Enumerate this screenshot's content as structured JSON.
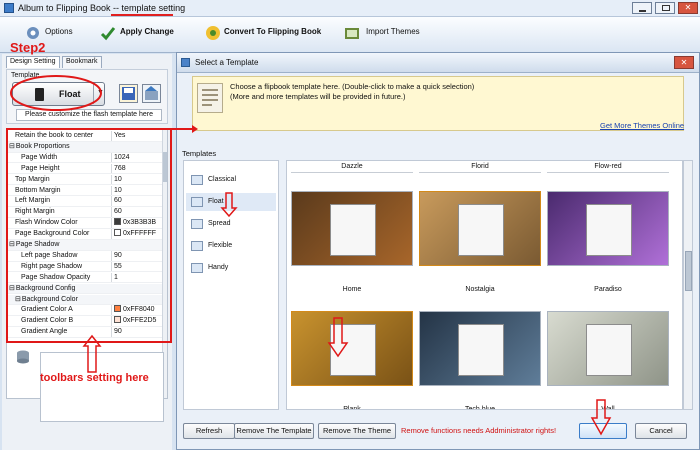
{
  "window": {
    "title": "Album to Flipping Book -- template setting"
  },
  "toolbar": {
    "options_label": "Options",
    "apply_label": "Apply Change",
    "convert_label": "Convert To Flipping Book",
    "themes_label": "Import Themes"
  },
  "left_panel": {
    "tabs": [
      "Design Setting",
      "Bookmark"
    ],
    "template_label": "Template",
    "template_value": "Float",
    "customize_text": "Please customize the flash template here",
    "properties": [
      {
        "label": "Retain the book to center",
        "value": "Yes",
        "indent": 1,
        "group": false
      },
      {
        "label": "Book Proportions",
        "value": "",
        "indent": 0,
        "group": true
      },
      {
        "label": "Page Width",
        "value": "1024",
        "indent": 2,
        "group": false
      },
      {
        "label": "Page Height",
        "value": "768",
        "indent": 2,
        "group": false
      },
      {
        "label": "Top Margin",
        "value": "10",
        "indent": 1,
        "group": false
      },
      {
        "label": "Bottom Margin",
        "value": "10",
        "indent": 1,
        "group": false
      },
      {
        "label": "Left Margin",
        "value": "60",
        "indent": 1,
        "group": false
      },
      {
        "label": "Right Margin",
        "value": "60",
        "indent": 1,
        "group": false
      },
      {
        "label": "Flash Window Color",
        "value": "0x3B3B3B",
        "indent": 1,
        "group": false,
        "swatch": "#3b3b3b"
      },
      {
        "label": "Page Background Color",
        "value": "0xFFFFFF",
        "indent": 1,
        "group": false,
        "swatch": "#ffffff"
      },
      {
        "label": "Page Shadow",
        "value": "",
        "indent": 0,
        "group": true
      },
      {
        "label": "Left page Shadow",
        "value": "90",
        "indent": 2,
        "group": false
      },
      {
        "label": "Right page Shadow",
        "value": "55",
        "indent": 2,
        "group": false
      },
      {
        "label": "Page Shadow Opacity",
        "value": "1",
        "indent": 2,
        "group": false
      },
      {
        "label": "Background Config",
        "value": "",
        "indent": 0,
        "group": true
      },
      {
        "label": "Background Color",
        "value": "",
        "indent": 1,
        "group": true
      },
      {
        "label": "Gradient Color A",
        "value": "0xFF8040",
        "indent": 2,
        "group": false,
        "swatch": "#ff8040"
      },
      {
        "label": "Gradient Color B",
        "value": "0xFFE2D5",
        "indent": 2,
        "group": false,
        "swatch": "#ffe2d5"
      },
      {
        "label": "Gradient Angle",
        "value": "90",
        "indent": 2,
        "group": false
      }
    ]
  },
  "dialog": {
    "title": "Select a Template",
    "info_line1": "Choose a flipbook template here. (Double-click to make a quick selection)",
    "info_line2": "(More and more templates will be provided in future.)",
    "more_link": "Get More Themes Online",
    "templates_header": "Templates",
    "templates": [
      "Classical",
      "Float",
      "Spread",
      "Flexible",
      "Handy"
    ],
    "selected_template": "Float",
    "top_captions": [
      "Dazzle",
      "Florid",
      "Flow-red"
    ],
    "thumbnails": [
      {
        "name": "Home",
        "bg": "#5a3a1c",
        "accent": "#a8662a"
      },
      {
        "name": "Nostalgia",
        "bg": "#c89a5c",
        "accent": "#7a5a32"
      },
      {
        "name": "Paradiso",
        "bg": "#4a2a6e",
        "accent": "#b070d8"
      },
      {
        "name": "Plank",
        "bg": "#c8922e",
        "accent": "#7a5216"
      },
      {
        "name": "Tech blue",
        "bg": "#243446",
        "accent": "#5f7d99"
      },
      {
        "name": "Wall",
        "bg": "#d8dbd0",
        "accent": "#8f9488"
      }
    ],
    "buttons": {
      "refresh": "Refresh",
      "remove_template": "Remove The Template",
      "remove_theme": "Remove The Theme",
      "ok": "",
      "cancel": "Cancel"
    },
    "warning": "Remove functions needs Addministrator rights!"
  },
  "annotations": {
    "step2": "Step2",
    "toolbars": "toolbars setting here"
  },
  "colors": {
    "annotation": "#e01818",
    "warning": "#d01010",
    "link": "#1a43b0"
  }
}
